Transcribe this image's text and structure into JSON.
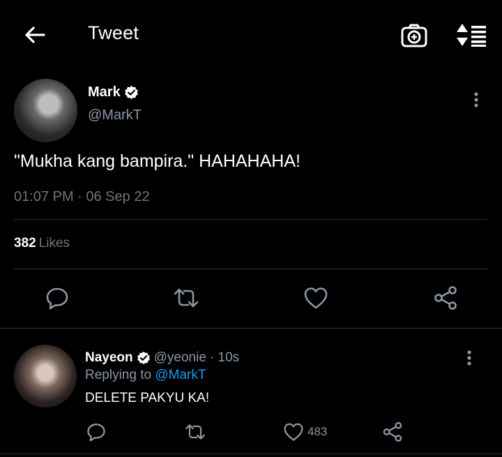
{
  "header": {
    "title": "Tweet",
    "back_icon": "arrow-left-icon",
    "camera_icon": "camera-plus-icon",
    "sort_icon": "sort-list-icon"
  },
  "tweet": {
    "author_name": "Mark",
    "author_handle": "@MarkT",
    "verified": true,
    "text": "\"Mukha kang bampira.\" HAHAHAHA!",
    "timestamp": "01:07 PM · 06 Sep 22",
    "likes_count": "382",
    "likes_label": "Likes"
  },
  "reply": {
    "author_name": "Nayeon",
    "author_handle": "@yeonie",
    "age": "· 10s",
    "replying_prefix": "Replying to",
    "replying_to": "@MarkT",
    "text": "DELETE PAKYU KA!",
    "like_count": "483"
  },
  "colors": {
    "background": "#000000",
    "text": "#ffffff",
    "secondary": "#8b98a5",
    "link": "#1d9bf0",
    "divider": "#2f3336"
  }
}
